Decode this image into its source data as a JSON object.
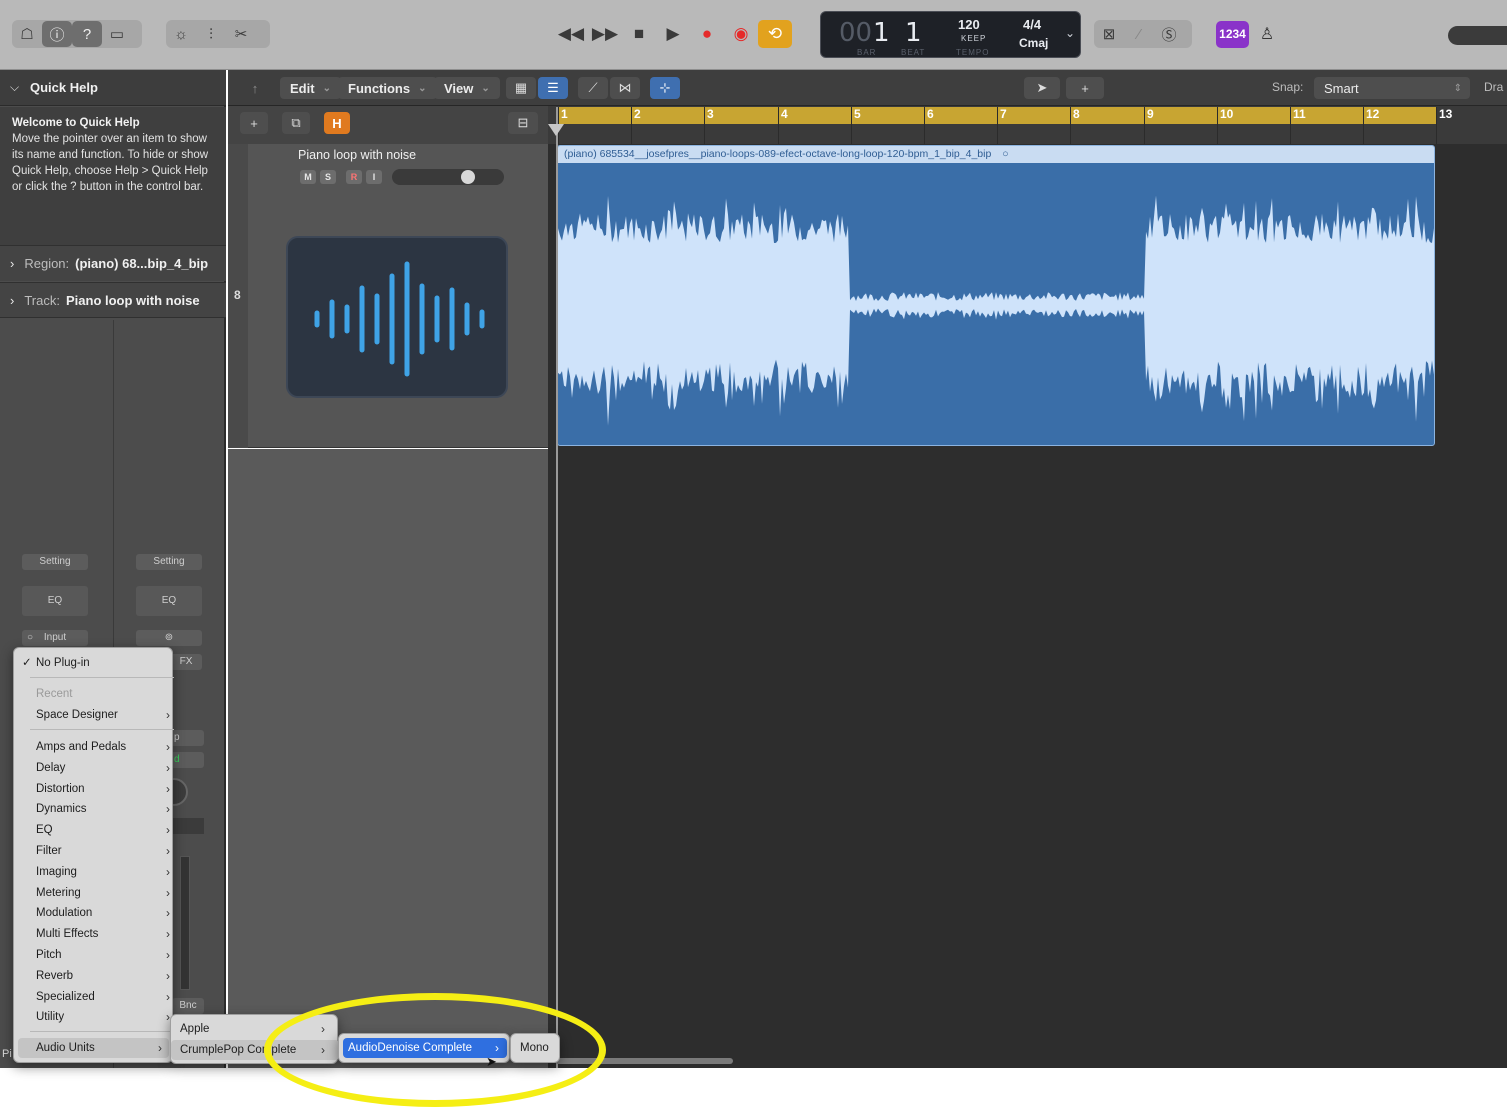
{
  "control_bar": {
    "lcd": {
      "bar_prefix": "00",
      "bar": "1",
      "beat": "1",
      "bar_caption": "BAR",
      "beat_caption": "BEAT",
      "tempo": "120",
      "tempo_mode": "KEEP",
      "tempo_caption": "TEMPO",
      "signature": "4/4",
      "key": "Cmaj"
    },
    "count_in_badge": "1234"
  },
  "quick_help": {
    "header": "Quick Help",
    "title": "Welcome to Quick Help",
    "body": "Move the pointer over an item to show its name and function. To hide or show Quick Help, choose Help > Quick Help or click the ? button in the control bar."
  },
  "inspector": {
    "region_label": "Region:",
    "region_value": "(piano) 68...bip_4_bip",
    "track_label": "Track:",
    "track_value": "Piano loop with noise",
    "strip_a": {
      "setting": "Setting",
      "eq": "EQ",
      "input": "Input"
    },
    "strip_b": {
      "setting": "Setting",
      "eq": "EQ",
      "fx_partial": "FX",
      "partial_p": "p",
      "partial_d": "d",
      "partial_bnc": "Bnc"
    },
    "bottom_partial": "Pi"
  },
  "track_toolbar": {
    "edit": "Edit",
    "functions": "Functions",
    "view": "View",
    "snap_label": "Snap:",
    "snap_value": "Smart",
    "drag_partial": "Dra"
  },
  "track": {
    "number": "8",
    "name": "Piano loop with noise",
    "buttons": [
      "M",
      "S",
      "R",
      "I"
    ],
    "hide_button": "H"
  },
  "ruler": {
    "bars": [
      "1",
      "2",
      "3",
      "4",
      "5",
      "6",
      "7",
      "8",
      "9",
      "10",
      "11",
      "12",
      "13"
    ]
  },
  "region": {
    "title": "(piano) 685534__josefpres__piano-loops-089-efect-octave-long-loop-120-bpm_1_bip_4_bip"
  },
  "plugin_menu": {
    "no_plugin": "No Plug-in",
    "recent_header": "Recent",
    "recent_items": [
      "Space Designer"
    ],
    "categories": [
      "Amps and Pedals",
      "Delay",
      "Distortion",
      "Dynamics",
      "EQ",
      "Filter",
      "Imaging",
      "Metering",
      "Modulation",
      "Multi Effects",
      "Pitch",
      "Reverb",
      "Specialized",
      "Utility"
    ],
    "audio_units": "Audio Units"
  },
  "submenu_vendors": {
    "items": [
      "Apple",
      "CrumplePop Complete"
    ]
  },
  "submenu_plugins": {
    "selected": "AudioDenoise Complete"
  },
  "submenu_format": {
    "item": "Mono"
  },
  "colors": {
    "accent_highlight": "#2f6fe0",
    "region_blue": "#3a6ea8",
    "waveform": "#cfe3fa",
    "cycle_bar": "#c8a532",
    "annotation_ring": "#f5ee14"
  }
}
